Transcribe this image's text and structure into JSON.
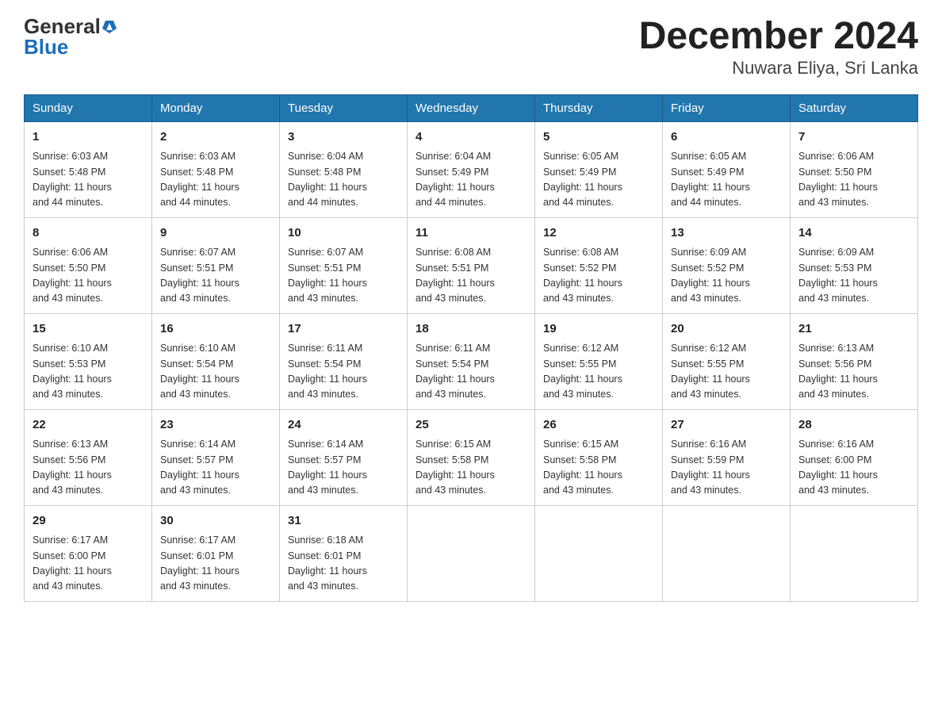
{
  "header": {
    "logo": {
      "general": "General",
      "blue": "Blue",
      "aria": "GeneralBlue logo"
    },
    "title": "December 2024",
    "location": "Nuwara Eliya, Sri Lanka"
  },
  "calendar": {
    "days_of_week": [
      "Sunday",
      "Monday",
      "Tuesday",
      "Wednesday",
      "Thursday",
      "Friday",
      "Saturday"
    ],
    "weeks": [
      [
        {
          "day": "1",
          "sunrise": "6:03 AM",
          "sunset": "5:48 PM",
          "daylight": "11 hours and 44 minutes."
        },
        {
          "day": "2",
          "sunrise": "6:03 AM",
          "sunset": "5:48 PM",
          "daylight": "11 hours and 44 minutes."
        },
        {
          "day": "3",
          "sunrise": "6:04 AM",
          "sunset": "5:48 PM",
          "daylight": "11 hours and 44 minutes."
        },
        {
          "day": "4",
          "sunrise": "6:04 AM",
          "sunset": "5:49 PM",
          "daylight": "11 hours and 44 minutes."
        },
        {
          "day": "5",
          "sunrise": "6:05 AM",
          "sunset": "5:49 PM",
          "daylight": "11 hours and 44 minutes."
        },
        {
          "day": "6",
          "sunrise": "6:05 AM",
          "sunset": "5:49 PM",
          "daylight": "11 hours and 44 minutes."
        },
        {
          "day": "7",
          "sunrise": "6:06 AM",
          "sunset": "5:50 PM",
          "daylight": "11 hours and 43 minutes."
        }
      ],
      [
        {
          "day": "8",
          "sunrise": "6:06 AM",
          "sunset": "5:50 PM",
          "daylight": "11 hours and 43 minutes."
        },
        {
          "day": "9",
          "sunrise": "6:07 AM",
          "sunset": "5:51 PM",
          "daylight": "11 hours and 43 minutes."
        },
        {
          "day": "10",
          "sunrise": "6:07 AM",
          "sunset": "5:51 PM",
          "daylight": "11 hours and 43 minutes."
        },
        {
          "day": "11",
          "sunrise": "6:08 AM",
          "sunset": "5:51 PM",
          "daylight": "11 hours and 43 minutes."
        },
        {
          "day": "12",
          "sunrise": "6:08 AM",
          "sunset": "5:52 PM",
          "daylight": "11 hours and 43 minutes."
        },
        {
          "day": "13",
          "sunrise": "6:09 AM",
          "sunset": "5:52 PM",
          "daylight": "11 hours and 43 minutes."
        },
        {
          "day": "14",
          "sunrise": "6:09 AM",
          "sunset": "5:53 PM",
          "daylight": "11 hours and 43 minutes."
        }
      ],
      [
        {
          "day": "15",
          "sunrise": "6:10 AM",
          "sunset": "5:53 PM",
          "daylight": "11 hours and 43 minutes."
        },
        {
          "day": "16",
          "sunrise": "6:10 AM",
          "sunset": "5:54 PM",
          "daylight": "11 hours and 43 minutes."
        },
        {
          "day": "17",
          "sunrise": "6:11 AM",
          "sunset": "5:54 PM",
          "daylight": "11 hours and 43 minutes."
        },
        {
          "day": "18",
          "sunrise": "6:11 AM",
          "sunset": "5:54 PM",
          "daylight": "11 hours and 43 minutes."
        },
        {
          "day": "19",
          "sunrise": "6:12 AM",
          "sunset": "5:55 PM",
          "daylight": "11 hours and 43 minutes."
        },
        {
          "day": "20",
          "sunrise": "6:12 AM",
          "sunset": "5:55 PM",
          "daylight": "11 hours and 43 minutes."
        },
        {
          "day": "21",
          "sunrise": "6:13 AM",
          "sunset": "5:56 PM",
          "daylight": "11 hours and 43 minutes."
        }
      ],
      [
        {
          "day": "22",
          "sunrise": "6:13 AM",
          "sunset": "5:56 PM",
          "daylight": "11 hours and 43 minutes."
        },
        {
          "day": "23",
          "sunrise": "6:14 AM",
          "sunset": "5:57 PM",
          "daylight": "11 hours and 43 minutes."
        },
        {
          "day": "24",
          "sunrise": "6:14 AM",
          "sunset": "5:57 PM",
          "daylight": "11 hours and 43 minutes."
        },
        {
          "day": "25",
          "sunrise": "6:15 AM",
          "sunset": "5:58 PM",
          "daylight": "11 hours and 43 minutes."
        },
        {
          "day": "26",
          "sunrise": "6:15 AM",
          "sunset": "5:58 PM",
          "daylight": "11 hours and 43 minutes."
        },
        {
          "day": "27",
          "sunrise": "6:16 AM",
          "sunset": "5:59 PM",
          "daylight": "11 hours and 43 minutes."
        },
        {
          "day": "28",
          "sunrise": "6:16 AM",
          "sunset": "6:00 PM",
          "daylight": "11 hours and 43 minutes."
        }
      ],
      [
        {
          "day": "29",
          "sunrise": "6:17 AM",
          "sunset": "6:00 PM",
          "daylight": "11 hours and 43 minutes."
        },
        {
          "day": "30",
          "sunrise": "6:17 AM",
          "sunset": "6:01 PM",
          "daylight": "11 hours and 43 minutes."
        },
        {
          "day": "31",
          "sunrise": "6:18 AM",
          "sunset": "6:01 PM",
          "daylight": "11 hours and 43 minutes."
        },
        null,
        null,
        null,
        null
      ]
    ],
    "labels": {
      "sunrise": "Sunrise:",
      "sunset": "Sunset:",
      "daylight": "Daylight:"
    }
  }
}
